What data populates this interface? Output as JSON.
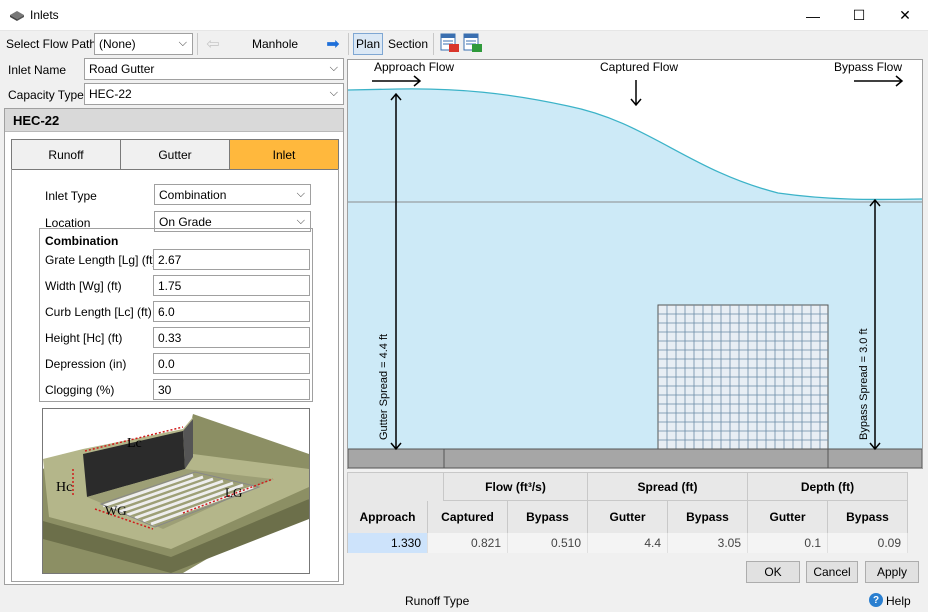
{
  "window": {
    "title": "Inlets",
    "minimize": "—",
    "maximize": "☐",
    "close": "✕"
  },
  "toolbar": {
    "flow_path_label": "Select Flow Path",
    "flow_path_value": "(None)",
    "back_arrow": "⇦",
    "current_node": "Manhole",
    "forward_arrow": "➡",
    "plan": "Plan",
    "section": "Section"
  },
  "inlet_name": {
    "label": "Inlet Name",
    "value": "Road Gutter"
  },
  "capacity_type": {
    "label": "Capacity Type",
    "value": "HEC-22"
  },
  "panel": {
    "heading": "HEC-22",
    "tabs": [
      "Runoff",
      "Gutter",
      "Inlet"
    ],
    "active_tab": "Inlet",
    "inlet_type": {
      "label": "Inlet Type",
      "value": "Combination"
    },
    "location": {
      "label": "Location",
      "value": "On Grade"
    },
    "group_title": "Combination",
    "fields": [
      {
        "label": "Grate Length [Lg] (ft)",
        "value": "2.67"
      },
      {
        "label": "Width [Wg] (ft)",
        "value": "1.75"
      },
      {
        "label": "Curb Length [Lc] (ft)",
        "value": "6.0"
      },
      {
        "label": "Height [Hc] (ft)",
        "value": "0.33"
      },
      {
        "label": "Depression (in)",
        "value": "0.0"
      },
      {
        "label": "Clogging (%)",
        "value": "30"
      }
    ],
    "diagram_labels": {
      "lc": "Lc",
      "hc": "Hc",
      "wg": "WG",
      "lg": "LG"
    }
  },
  "plot": {
    "approach_flow": "Approach Flow",
    "captured_flow": "Captured Flow",
    "bypass_flow": "Bypass Flow",
    "gutter_spread": "Gutter Spread = 4.4 ft",
    "bypass_spread": "Bypass Spread = 3.0 ft",
    "colors": {
      "water": "#cdeaf7",
      "water_edge": "#3cb3c8",
      "road": "#a6a6a6",
      "grate": "#e8eef4"
    }
  },
  "results": {
    "groups": [
      "Flow (ft³/s)",
      "Spread (ft)",
      "Depth (ft)"
    ],
    "columns": [
      "Approach",
      "Captured",
      "Bypass",
      "Gutter",
      "Bypass",
      "Gutter",
      "Bypass"
    ],
    "row": [
      "1.330",
      "0.821",
      "0.510",
      "4.4",
      "3.05",
      "0.1",
      "0.09"
    ]
  },
  "buttons": {
    "ok": "OK",
    "cancel": "Cancel",
    "apply": "Apply"
  },
  "status": {
    "text": "Runoff Type",
    "help": "Help",
    "help_glyph": "?"
  }
}
